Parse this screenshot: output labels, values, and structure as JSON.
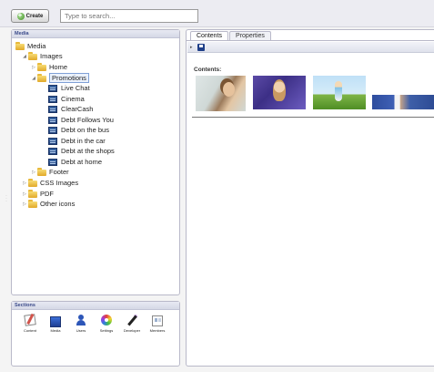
{
  "toolbar": {
    "create_label": "Create",
    "search_placeholder": "Type to search..."
  },
  "media_panel": {
    "title": "Media",
    "tree": [
      {
        "label": "Media",
        "icon": "folder-icon"
      },
      {
        "label": "Images",
        "icon": "folder-icon",
        "expanded": true
      },
      {
        "label": "Home",
        "icon": "folder-icon",
        "expanded": false
      },
      {
        "label": "Promotions",
        "icon": "folder-icon",
        "expanded": true,
        "selected": true
      },
      {
        "label": "Live Chat",
        "icon": "image-icon"
      },
      {
        "label": "Cinema",
        "icon": "image-icon"
      },
      {
        "label": "ClearCash",
        "icon": "image-icon"
      },
      {
        "label": "Debt Follows You",
        "icon": "image-icon"
      },
      {
        "label": "Debt on the bus",
        "icon": "image-icon"
      },
      {
        "label": "Debt in the car",
        "icon": "image-icon"
      },
      {
        "label": "Debt at the shops",
        "icon": "image-icon"
      },
      {
        "label": "Debt at home",
        "icon": "image-icon"
      },
      {
        "label": "Footer",
        "icon": "folder-icon",
        "expanded": false
      },
      {
        "label": "CSS Images",
        "icon": "folder-icon",
        "expanded": false
      },
      {
        "label": "PDF",
        "icon": "folder-icon",
        "expanded": false
      },
      {
        "label": "Other icons",
        "icon": "folder-icon",
        "expanded": false
      }
    ]
  },
  "sections_panel": {
    "title": "Sections",
    "items": [
      {
        "label": "Content",
        "icon": "content-icon"
      },
      {
        "label": "Media",
        "icon": "media-icon"
      },
      {
        "label": "Users",
        "icon": "users-icon"
      },
      {
        "label": "Settings",
        "icon": "settings-icon"
      },
      {
        "label": "Developer",
        "icon": "developer-icon"
      },
      {
        "label": "Members",
        "icon": "members-icon"
      }
    ]
  },
  "content_panel": {
    "tabs": [
      {
        "label": "Contents",
        "active": true
      },
      {
        "label": "Properties",
        "active": false
      }
    ],
    "contents_label": "Contents:",
    "thumbnails": [
      "live-chat-thumbnail",
      "promo-woman-thumbnail",
      "field-thumbnail",
      "banner-thumbnail"
    ]
  },
  "colors": {
    "panel_border": "#b9b9c9",
    "header_text": "#3a4a8a",
    "folder": "#e8b93a",
    "create_icon": "#3f8e22"
  }
}
